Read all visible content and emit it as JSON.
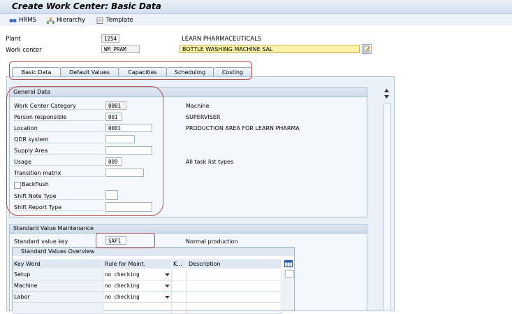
{
  "window": {
    "title": "Create Work Center: Basic Data"
  },
  "toolbar": {
    "hrms": "HRMS",
    "hierarchy": "Hierarchy",
    "template": "Template"
  },
  "header": {
    "plant_label": "Plant",
    "plant_value": "1254",
    "plant_desc": "LEARN PHARMACEUTICALS",
    "workcenter_label": "Work center",
    "workcenter_value": "WM_PRAM",
    "workcenter_desc": "BOTTLE WASHING MACHINE SAL"
  },
  "tabs": [
    "Basic Data",
    "Default Values",
    "Capacities",
    "Scheduling",
    "Costing"
  ],
  "general": {
    "title": "General Data",
    "fields": [
      {
        "label": "Work Center Category",
        "value": "0001",
        "desc": "Machine"
      },
      {
        "label": "Person responsible",
        "value": "001",
        "desc": "SUPERVISER"
      },
      {
        "label": "Location",
        "value": "0001",
        "desc": "PRODUCTION AREA FOR LEARN PHARMA"
      },
      {
        "label": "QDR system",
        "value": "",
        "desc": ""
      },
      {
        "label": "Supply Area",
        "value": "",
        "desc": ""
      },
      {
        "label": "Usage",
        "value": "009",
        "desc": "All task list types"
      },
      {
        "label": "Transition matrix",
        "value": "",
        "desc": ""
      }
    ],
    "backflush": "Backflush",
    "shift_note_label": "Shift Note Type",
    "shift_report_label": "Shift Report Type"
  },
  "standard": {
    "title": "Standard Value Maintenance",
    "key_label": "Standard value key",
    "key_value": "SAP1",
    "key_desc": "Normal production",
    "overview_title": "Standard Values Overview",
    "columns": [
      "Key Word",
      "Rule for Maint.",
      "K...",
      "Description"
    ],
    "rows": [
      {
        "keyword": "Setup",
        "rule": "no checking"
      },
      {
        "keyword": "Machine",
        "rule": "no checking"
      },
      {
        "keyword": "Labor",
        "rule": "no checking"
      }
    ]
  },
  "colors": {
    "accent": "#b64c4c",
    "panel": "#eaf1f9",
    "highlight": "#fdf3a6"
  }
}
